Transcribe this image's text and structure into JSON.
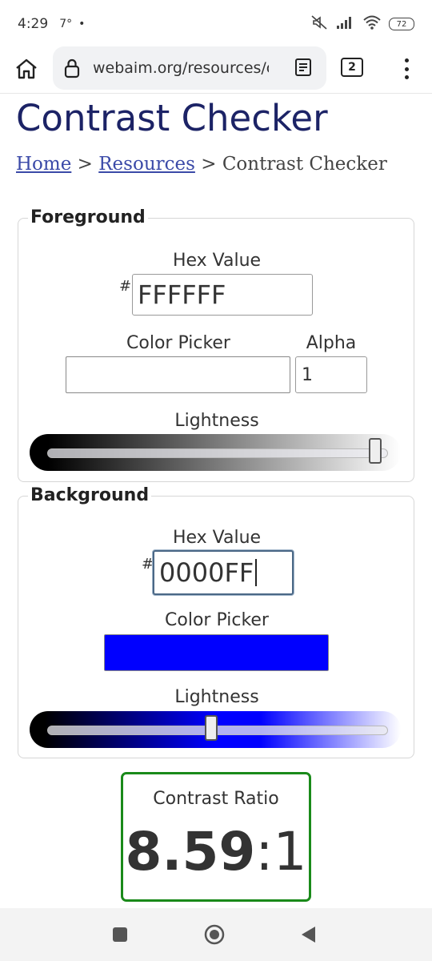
{
  "status_bar": {
    "time": "4:29",
    "temperature": "7°",
    "dot": "•",
    "battery": "72"
  },
  "browser": {
    "url": "webaim.org/resources/contrastchecker",
    "tab_count": "2"
  },
  "page": {
    "title": "Contrast Checker",
    "breadcrumb": {
      "home": "Home",
      "sep1": " > ",
      "resources": "Resources",
      "sep2": " > ",
      "current": "Contrast Checker"
    }
  },
  "foreground": {
    "legend": "Foreground",
    "hex_label": "Hex Value",
    "hash": "#",
    "hex_value": "FFFFFF",
    "picker_label": "Color Picker",
    "picker_color": "#ffffff",
    "alpha_label": "Alpha",
    "alpha_value": "1",
    "lightness_label": "Lightness",
    "lightness": 1.0
  },
  "background": {
    "legend": "Background",
    "hex_label": "Hex Value",
    "hash": "#",
    "hex_value": "0000FF",
    "picker_label": "Color Picker",
    "picker_color": "#0000ff",
    "lightness_label": "Lightness",
    "lightness": 0.5
  },
  "contrast": {
    "label": "Contrast Ratio",
    "ratio": "8.59",
    "suffix": ":1",
    "border_color": "#1a8a1a"
  },
  "colors": {
    "title": "#1c2366",
    "link": "#3b4aa8"
  }
}
